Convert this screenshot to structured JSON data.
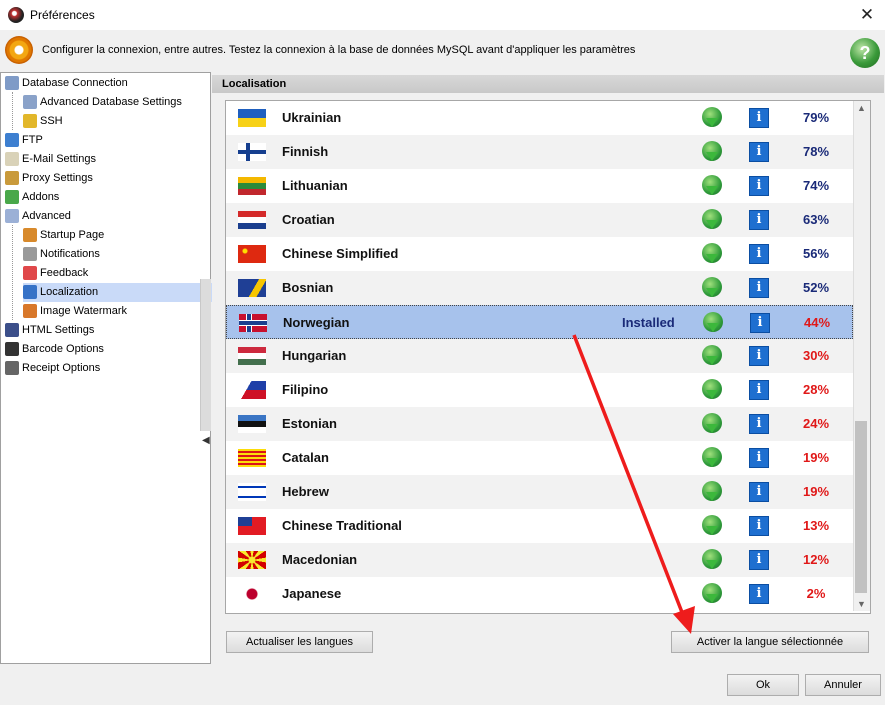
{
  "window": {
    "title": "Préférences",
    "close_glyph": "✕"
  },
  "info": {
    "text": "Configurer la connexion, entre autres. Testez la connexion à la base de données MySQL avant d'appliquer les paramètres",
    "help_glyph": "?"
  },
  "sidebar": {
    "items": [
      {
        "label": "Database Connection",
        "icon": "database-icon"
      },
      {
        "label": "Advanced Database Settings",
        "icon": "database-settings-icon"
      },
      {
        "label": "SSH",
        "icon": "lock-icon"
      },
      {
        "label": "FTP",
        "icon": "ftp-icon"
      },
      {
        "label": "E-Mail Settings",
        "icon": "envelope-icon"
      },
      {
        "label": "Proxy Settings",
        "icon": "proxy-icon"
      },
      {
        "label": "Addons",
        "icon": "puzzle-icon"
      },
      {
        "label": "Advanced",
        "icon": "shield-icon"
      },
      {
        "label": "Startup Page",
        "icon": "home-icon"
      },
      {
        "label": "Notifications",
        "icon": "notification-icon"
      },
      {
        "label": "Feedback",
        "icon": "feedback-icon"
      },
      {
        "label": "Localization",
        "icon": "localization-icon"
      },
      {
        "label": "Image Watermark",
        "icon": "image-icon"
      },
      {
        "label": "HTML Settings",
        "icon": "html-icon"
      },
      {
        "label": "Barcode Options",
        "icon": "barcode-icon"
      },
      {
        "label": "Receipt Options",
        "icon": "receipt-icon"
      }
    ],
    "selected": "Localization"
  },
  "section": {
    "title": "Localisation"
  },
  "languages": [
    {
      "name": "Ukrainian",
      "percent": "79%",
      "status": "",
      "flag": "ukraine-flag"
    },
    {
      "name": "Finnish",
      "percent": "78%",
      "status": "",
      "flag": "finland-flag"
    },
    {
      "name": "Lithuanian",
      "percent": "74%",
      "status": "",
      "flag": "lithuania-flag"
    },
    {
      "name": "Croatian",
      "percent": "63%",
      "status": "",
      "flag": "croatia-flag"
    },
    {
      "name": "Chinese Simplified",
      "percent": "56%",
      "status": "",
      "flag": "china-flag"
    },
    {
      "name": "Bosnian",
      "percent": "52%",
      "status": "",
      "flag": "bosnia-flag"
    },
    {
      "name": "Norwegian",
      "percent": "44%",
      "status": "Installed",
      "flag": "norway-flag"
    },
    {
      "name": "Hungarian",
      "percent": "30%",
      "status": "",
      "flag": "hungary-flag"
    },
    {
      "name": "Filipino",
      "percent": "28%",
      "status": "",
      "flag": "philippines-flag"
    },
    {
      "name": "Estonian",
      "percent": "24%",
      "status": "",
      "flag": "estonia-flag"
    },
    {
      "name": "Catalan",
      "percent": "19%",
      "status": "",
      "flag": "catalonia-flag"
    },
    {
      "name": "Hebrew",
      "percent": "19%",
      "status": "",
      "flag": "israel-flag"
    },
    {
      "name": "Chinese Traditional",
      "percent": "13%",
      "status": "",
      "flag": "taiwan-flag"
    },
    {
      "name": "Macedonian",
      "percent": "12%",
      "status": "",
      "flag": "macedonia-flag"
    },
    {
      "name": "Japanese",
      "percent": "2%",
      "status": "",
      "flag": "japan-flag"
    }
  ],
  "selected_language": "Norwegian",
  "info_glyph": "i",
  "buttons": {
    "refresh": "Actualiser les langues",
    "activate": "Activer la langue sélectionnée",
    "ok": "Ok",
    "cancel": "Annuler"
  },
  "colors": {
    "high_percent": "#1a2a78",
    "low_percent": "#e01818",
    "selection": "#a7c2ec",
    "annotation_arrow": "#ee1c1c"
  }
}
